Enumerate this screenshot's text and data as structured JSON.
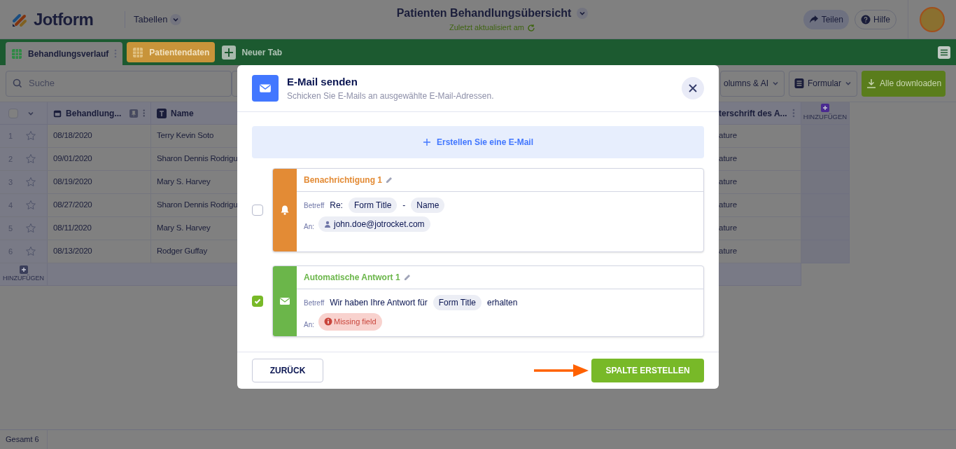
{
  "header": {
    "logo": "Jotform",
    "menu": "Tabellen",
    "title": "Patienten Behandlungsübersicht",
    "subtitle": "Zuletzt aktualisiert am",
    "buttons": [
      {
        "kind": "share",
        "label": "Teilen"
      },
      {
        "kind": "help",
        "label": "Hilfe"
      }
    ]
  },
  "tabs": [
    {
      "kind": "sheet",
      "label": "Behandlungsverlauf",
      "selected": true,
      "color": "#2e8a44"
    },
    {
      "kind": "sheet",
      "label": "Patientendaten",
      "selected": false,
      "color": "#c8943a"
    },
    {
      "kind": "add",
      "label": "Neuer Tab"
    }
  ],
  "toolbar": {
    "search_placeholder": "Suche",
    "buttons": [
      {
        "kind": "menu",
        "label": "olumns & AI"
      },
      {
        "kind": "form",
        "label": "Formular"
      },
      {
        "kind": "download",
        "label": "Alle downloaden"
      }
    ]
  },
  "table": {
    "select_all": {
      "checked": false
    },
    "columns": [
      {
        "kind": "date",
        "label": "Behandlung..."
      },
      {
        "kind": "text",
        "label": "Name"
      },
      {
        "kind": "plain",
        "label": "terschrift des A..."
      }
    ],
    "add_column": "HINZUFÜGEN",
    "rows": [
      {
        "number": "1",
        "starred": false,
        "cells": [
          "08/18/2020",
          "Terry Kevin Soto",
          "ature"
        ]
      },
      {
        "number": "2",
        "starred": false,
        "cells": [
          "09/01/2020",
          "Sharon Dennis Rodrigu",
          "ature"
        ]
      },
      {
        "number": "3",
        "starred": false,
        "cells": [
          "08/19/2020",
          "Mary S. Harvey",
          "ature"
        ]
      },
      {
        "number": "4",
        "starred": false,
        "cells": [
          "08/27/2020",
          "Sharon Dennis Rodrigu",
          "ature"
        ]
      },
      {
        "number": "5",
        "starred": false,
        "cells": [
          "08/11/2020",
          "Mary S. Harvey",
          "ature"
        ]
      },
      {
        "number": "6",
        "starred": false,
        "cells": [
          "08/13/2020",
          "Rodger Guffay",
          "ature"
        ]
      }
    ],
    "add_row": "HINZUFÜGEN"
  },
  "status_bar": "Gesamt 6",
  "modal": {
    "title": "E-Mail senden",
    "subtitle": "Schicken Sie E-Mails an ausgewählte E-Mail-Adressen.",
    "create_button": "Erstellen Sie eine E-Mail",
    "emails": [
      {
        "kind": "notification",
        "title": "Benachrichtigung 1",
        "color": "#e38b35",
        "checked": false,
        "subject_label": "Betreff",
        "to_label": "An:",
        "subject": [
          {
            "kind": "text",
            "text": "Re:"
          },
          {
            "kind": "tag",
            "text": "Form Title"
          },
          {
            "kind": "text",
            "text": "-"
          },
          {
            "kind": "tag",
            "text": "Name"
          }
        ],
        "to": {
          "kind": "recipient",
          "text": "john.doe@jotrocket.com"
        }
      },
      {
        "kind": "autoresponder",
        "title": "Automatische Antwort 1",
        "color": "#6bb64a",
        "checked": true,
        "subject_label": "Betreff",
        "to_label": "An:",
        "subject": [
          {
            "kind": "text",
            "text": "Wir haben Ihre Antwort für"
          },
          {
            "kind": "tag",
            "text": "Form Title"
          },
          {
            "kind": "text",
            "text": "erhalten"
          }
        ],
        "to": {
          "kind": "missing",
          "text": "Missing field"
        }
      }
    ],
    "back_button": "ZURÜCK",
    "submit_button": "SPALTE ERSTELLEN"
  }
}
